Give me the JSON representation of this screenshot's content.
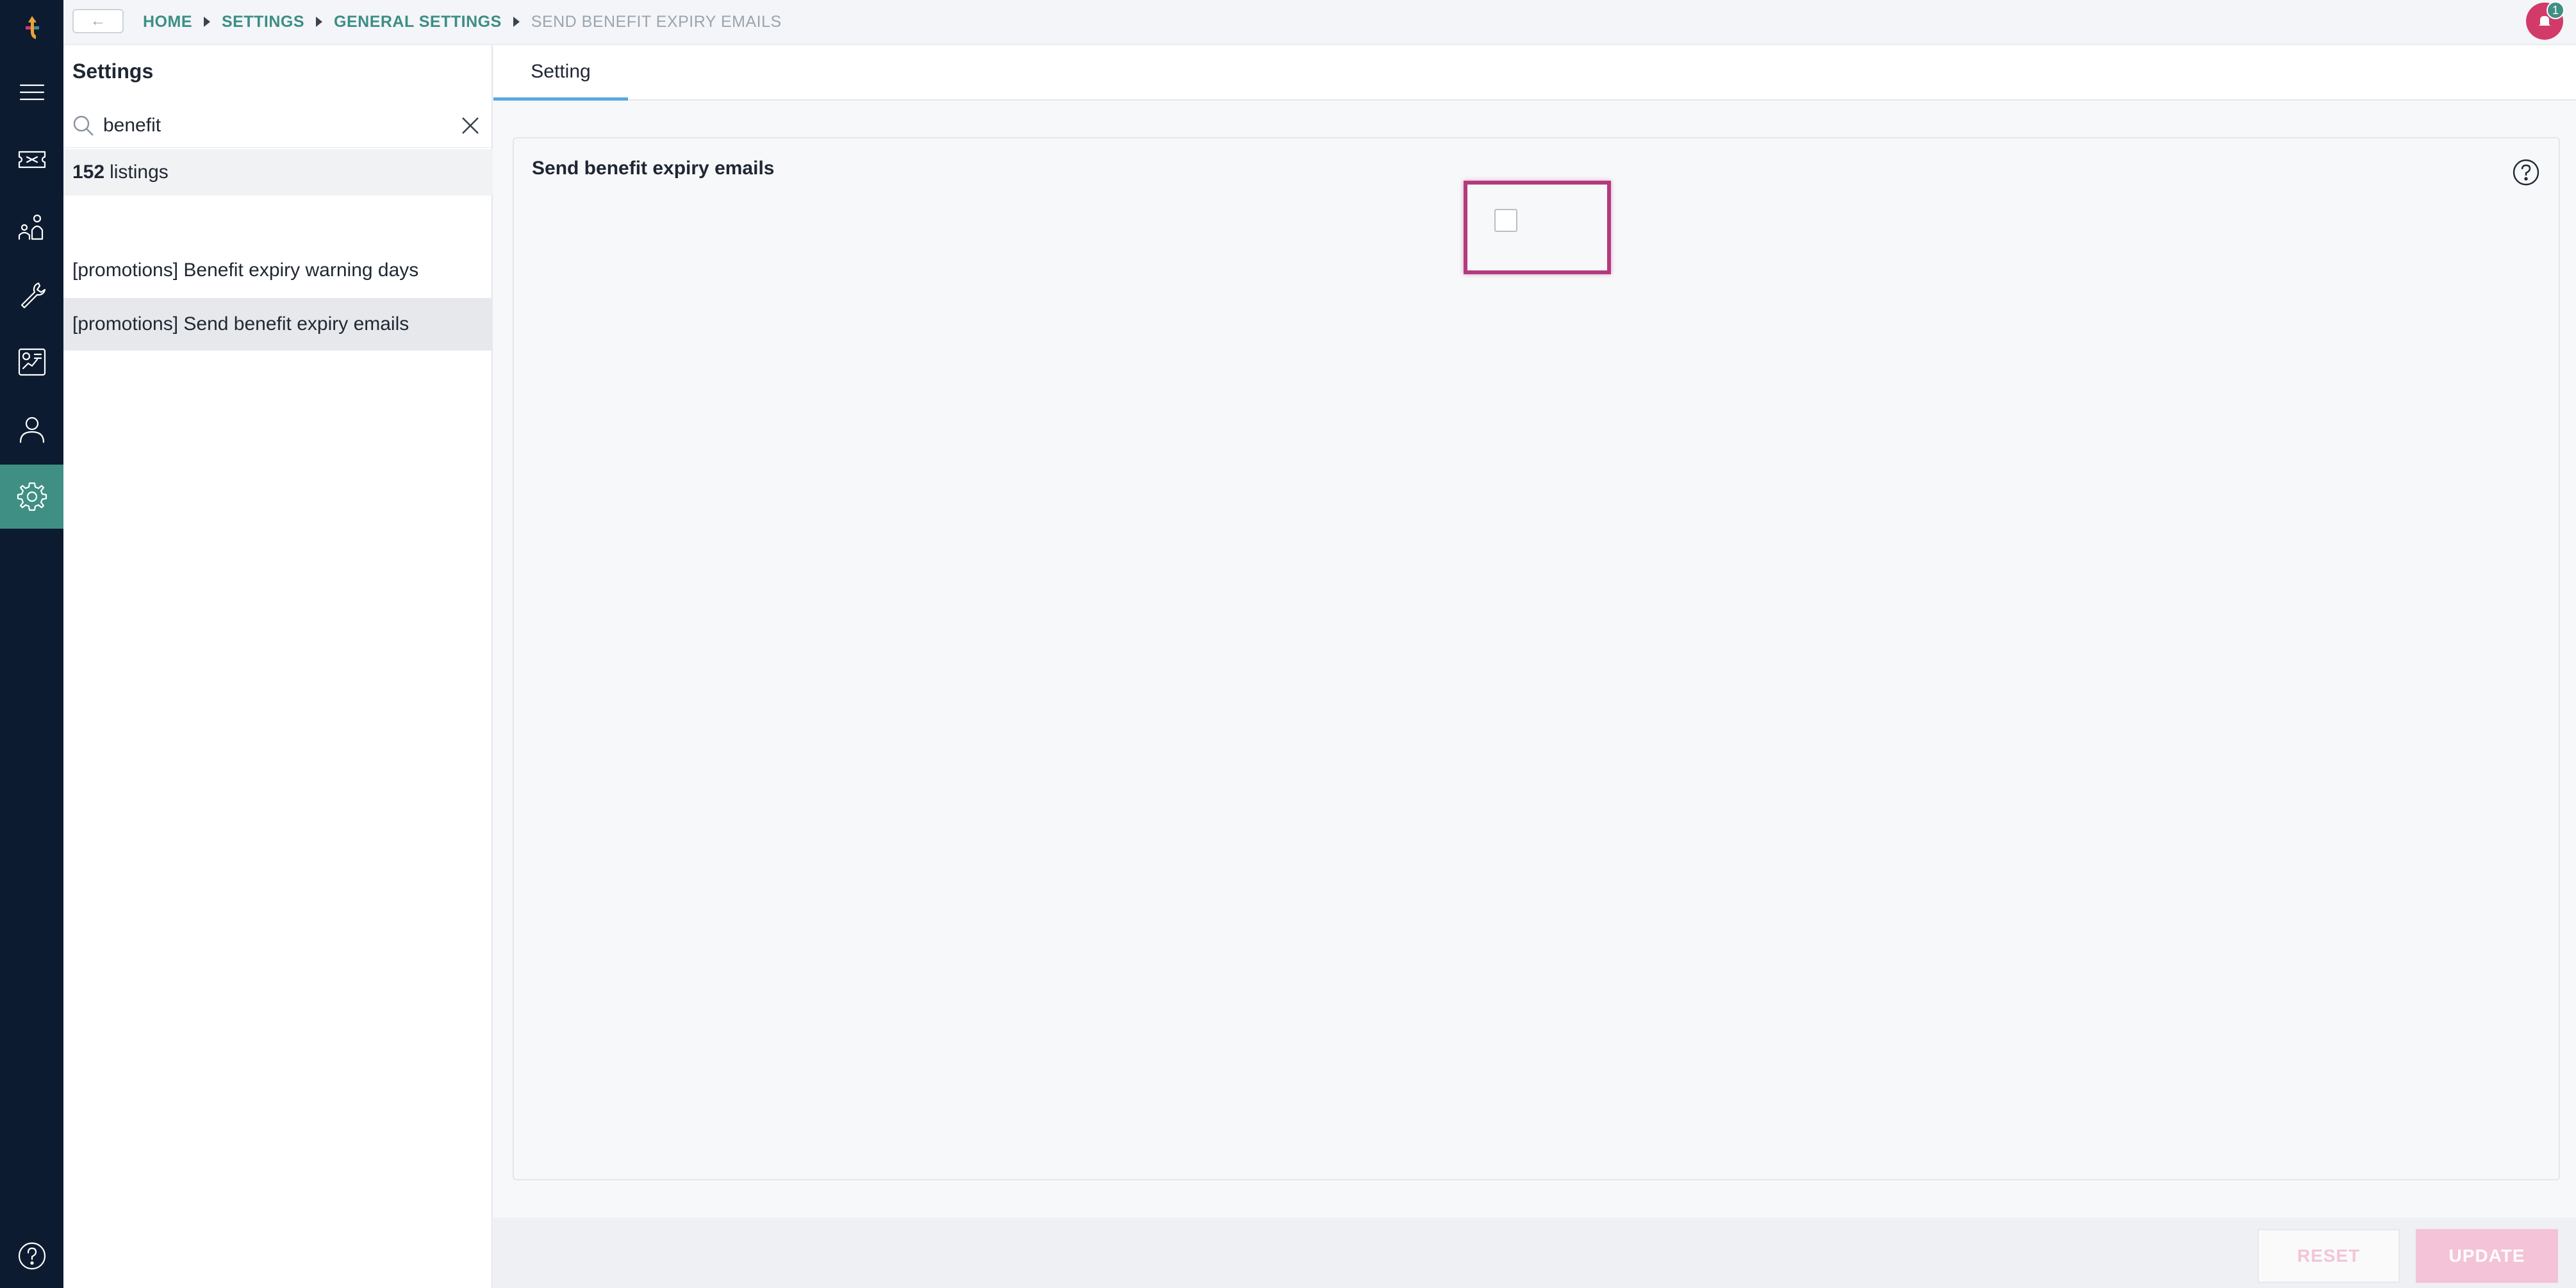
{
  "breadcrumbs": [
    "HOME",
    "SETTINGS",
    "GENERAL SETTINGS",
    "SEND BENEFIT EXPIRY EMAILS"
  ],
  "back_label": "←",
  "notifications": {
    "count": "1"
  },
  "rail": {
    "items": [
      {
        "name": "menu-icon",
        "active": false
      },
      {
        "name": "ticket-icon",
        "active": false
      },
      {
        "name": "people-icon",
        "active": false
      },
      {
        "name": "wrench-icon",
        "active": false
      },
      {
        "name": "report-icon",
        "active": false
      },
      {
        "name": "user-icon",
        "active": false
      },
      {
        "name": "gear-icon",
        "active": true
      },
      {
        "name": "help-icon",
        "active": false
      }
    ],
    "active_color": "#3f8f84",
    "bg_color": "#0d1b30"
  },
  "settings_panel": {
    "title": "Settings",
    "search": {
      "value": "benefit",
      "placeholder": ""
    },
    "count_number": "152",
    "count_label": "listings",
    "items": [
      {
        "label": "[promotions] Benefit expiry warning days",
        "selected": false
      },
      {
        "label": "[promotions] Send benefit expiry emails",
        "selected": true
      }
    ]
  },
  "main": {
    "tab": "Setting",
    "setting_label": "Send benefit expiry emails",
    "checkbox_checked": false,
    "highlight_color": "#b43a7e"
  },
  "footer": {
    "reset_label": "RESET",
    "update_label": "UPDATE"
  }
}
